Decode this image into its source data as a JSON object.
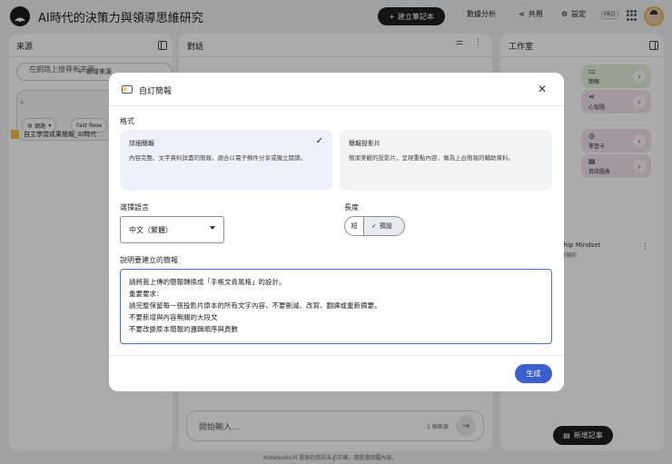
{
  "app": {
    "title": "AI時代的決策力與領導思維研究",
    "new_notebook": "建立筆記本",
    "analytics": "數據分析",
    "share": "共用",
    "settings": "設定",
    "pro": "PRO"
  },
  "sources": {
    "title": "來源",
    "add_source": "新增來源",
    "search_placeholder": "在網路上搜尋新來源",
    "chip_web": "網路",
    "chip_research": "Fast Rese",
    "item": "自主學習成果簡報_AI時代"
  },
  "chat": {
    "title": "對話",
    "input_placeholder": "開始輸入...",
    "source_count": "1 個來源",
    "footer": "NotebookLM 提供的資訊未必正確，請查證回覆內容。"
  },
  "studio": {
    "title": "工作室",
    "cards": [
      {
        "label": "簡報",
        "color": "#e7f2dc"
      },
      {
        "label": "心智圖",
        "color": "#f3e3ee"
      },
      {
        "label": "學習卡",
        "color": "#f3e3ee"
      },
      {
        "label": "資訊圖表",
        "color": "#f3e3ee"
      }
    ],
    "note_title": "ship Mindset",
    "note_sub": "分鐘前",
    "add_note": "新增記事"
  },
  "modal": {
    "title": "自訂簡報",
    "format_label": "格式",
    "formats": [
      {
        "title": "詳細簡報",
        "desc": "內容完整、文字資料詳盡的簡報，適合以電子郵件分享或獨立閱讀。"
      },
      {
        "title": "簡報投影片",
        "desc": "簡潔美觀的投影片，呈現重點內容，做為上台簡報的輔助資料。"
      }
    ],
    "language_label": "選擇語言",
    "language_value": "中文（繁體）",
    "length_label": "長度",
    "length_short": "短",
    "length_default": "預設",
    "prompt_label": "說明要建立的簡報",
    "prompt_lines": [
      "請將我上傳的簡報轉換成「手帳文青風格」的設計。",
      "重要要求：",
      "請完整保留每一張投影片原本的所有文字內容，不要刪減、改寫、翻譯或重新摘要。",
      "不要新增與內容無關的大段文",
      "不要改變原本簡報的邏輯順序與頁數"
    ],
    "generate": "生成"
  }
}
